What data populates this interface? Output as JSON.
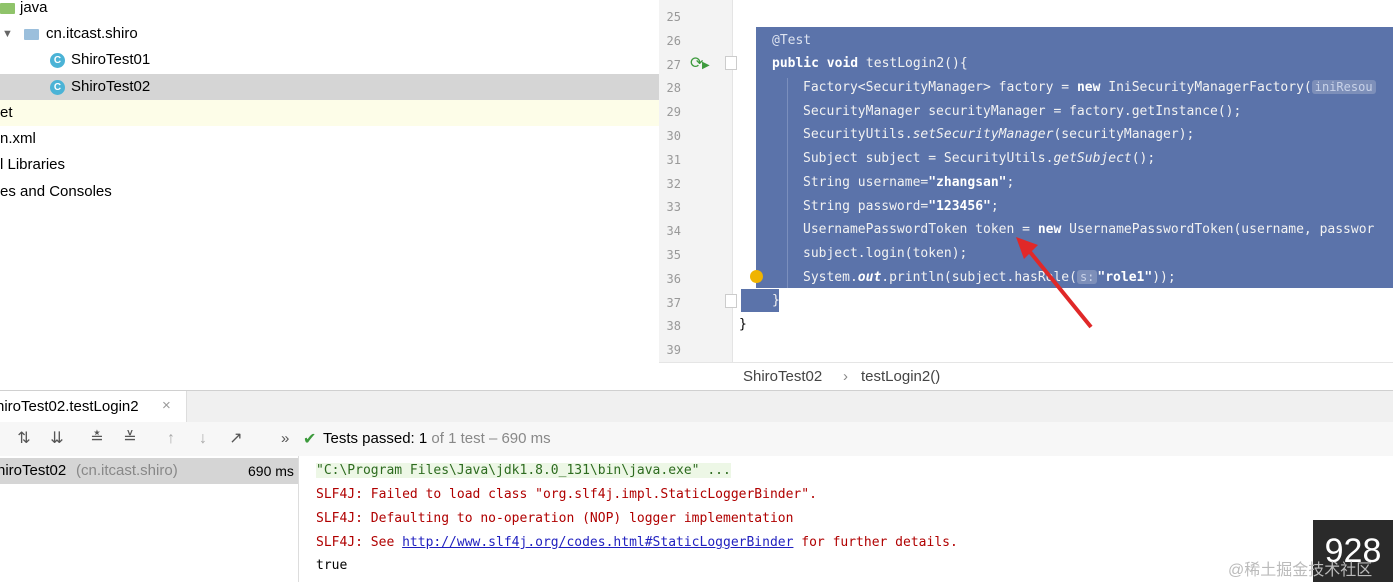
{
  "project_tree": {
    "items": [
      {
        "label": "java",
        "icon": "folder-icon"
      },
      {
        "label": "cn.itcast.shiro",
        "icon": "package-icon"
      },
      {
        "label": "ShiroTest01",
        "icon": "class-icon"
      },
      {
        "label": "ShiroTest02",
        "icon": "class-icon"
      },
      {
        "label": "et",
        "icon": ""
      },
      {
        "label": "n.xml",
        "icon": ""
      },
      {
        "label": "l Libraries",
        "icon": ""
      },
      {
        "label": "es and Consoles",
        "icon": ""
      }
    ]
  },
  "editor": {
    "line_numbers": [
      "25",
      "26",
      "27",
      "28",
      "29",
      "30",
      "31",
      "32",
      "33",
      "34",
      "35",
      "36",
      "37",
      "38",
      "39"
    ],
    "annotation": "@Test",
    "method_sig": {
      "kw": "public void",
      "rest": " testLogin2(){"
    },
    "lines": {
      "l28_a": "Factory<SecurityManager> factory = ",
      "l28_kw": "new",
      "l28_b": " IniSecurityManagerFactory(",
      "l28_hint": "iniResou",
      "l29": "SecurityManager securityManager = factory.getInstance();",
      "l30_a": "SecurityUtils.",
      "l30_it": "setSecurityManager",
      "l30_b": "(securityManager);",
      "l31_a": "Subject subject = SecurityUtils.",
      "l31_it": "getSubject",
      "l31_b": "();",
      "l32_a": "String username=",
      "l32_str": "\"zhangsan\"",
      "l32_b": ";",
      "l33_a": "String password=",
      "l33_str": "\"123456\"",
      "l33_b": ";",
      "l34_a": "UsernamePasswordToken token = ",
      "l34_kw": "new",
      "l34_b": " UsernamePasswordToken(username, passwor",
      "l35": "subject.login(token);",
      "l36_a": "System.",
      "l36_it": "out",
      "l36_b": ".println(subject.hasRole(",
      "l36_hint": "s:",
      "l36_str": "\"role1\"",
      "l36_c": "));",
      "l37": "}",
      "l38": "}"
    },
    "breadcrumb": {
      "class": "ShiroTest02",
      "sep": "›",
      "method": "testLogin2()"
    }
  },
  "run_panel": {
    "tab_label": "hiroTest02.testLogin2",
    "tab_close": "×",
    "status": {
      "passed": "Tests passed:",
      "count": "1",
      "detail": "of 1 test – 690 ms"
    },
    "expand": "»",
    "test_item": {
      "name": "hiroTest02",
      "package": "(cn.itcast.shiro)",
      "time": "690 ms"
    },
    "console": [
      "\"C:\\Program Files\\Java\\jdk1.8.0_131\\bin\\java.exe\" ...",
      "SLF4J: Failed to load class \"org.slf4j.impl.StaticLoggerBinder\".",
      "SLF4J: Defaulting to no-operation (NOP) logger implementation",
      "true"
    ],
    "console_see": "SLF4J: See ",
    "console_link": "http://www.slf4j.org/codes.html#StaticLoggerBinder",
    "console_after": " for further details."
  },
  "watermark": {
    "number": "928",
    "text": "@稀土掘金技术社区"
  },
  "colors": {
    "selection": "#5b73aa",
    "pass": "#3c9a3c",
    "error": "#b00000"
  }
}
